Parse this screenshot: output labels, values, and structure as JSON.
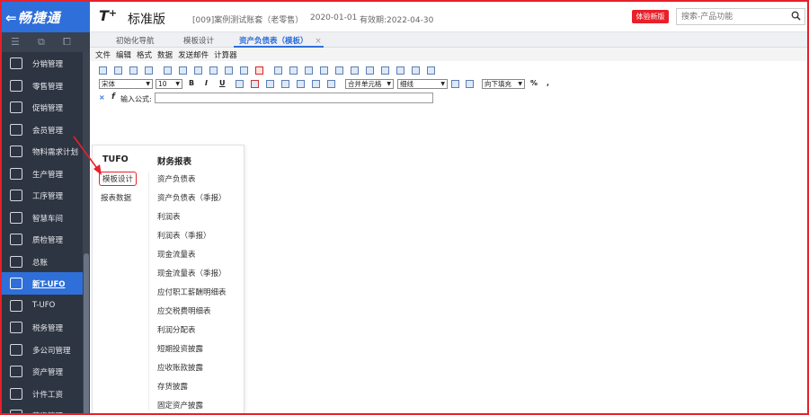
{
  "header": {
    "logo": "⇐畅捷通",
    "product": "T",
    "product_sup": "+",
    "edition": "标准版",
    "account": "[009]案例测试账套（老零售）",
    "date": "2020-01-01",
    "validity": "有效期:2022-04-30",
    "trial_button": "体验新版",
    "search_placeholder": "搜索-产品功能"
  },
  "sidebar": {
    "items": [
      {
        "label": "分销管理",
        "icon": "org-chart-icon"
      },
      {
        "label": "零售管理",
        "icon": "store-icon"
      },
      {
        "label": "促销管理",
        "icon": "megaphone-icon"
      },
      {
        "label": "会员管理",
        "icon": "member-card-icon"
      },
      {
        "label": "物料需求计划",
        "icon": "cube-icon"
      },
      {
        "label": "生产管理",
        "icon": "production-icon"
      },
      {
        "label": "工序管理",
        "icon": "process-icon"
      },
      {
        "label": "智慧车间",
        "icon": "workshop-icon"
      },
      {
        "label": "质检管理",
        "icon": "shield-check-icon"
      },
      {
        "label": "总账",
        "icon": "ledger-icon"
      },
      {
        "label": "新T-UFO",
        "icon": "ufo-icon"
      },
      {
        "label": "T-UFO",
        "icon": "table-icon"
      },
      {
        "label": "税务管理",
        "icon": "tax-icon"
      },
      {
        "label": "多公司管理",
        "icon": "company-icon"
      },
      {
        "label": "资产管理",
        "icon": "bank-icon"
      },
      {
        "label": "计件工资",
        "icon": "wage-icon"
      },
      {
        "label": "薪资管理",
        "icon": "salary-icon"
      }
    ],
    "active_index": 10
  },
  "tabs": [
    {
      "label": "初始化导航"
    },
    {
      "label": "模板设计"
    },
    {
      "label": "资产负债表（模板）",
      "close": "×"
    }
  ],
  "menubar": [
    "文件",
    "编辑",
    "格式",
    "数据",
    "发送邮件",
    "计算器"
  ],
  "format_bar": {
    "font": "宋体",
    "size": "10",
    "bold": "B",
    "italic": "I",
    "underline": "U",
    "merge": "合并单元格",
    "border": "细线",
    "fill": "向下填充",
    "percent": "%",
    "comma": ","
  },
  "formula_bar": {
    "cancel": "×",
    "fx": "f",
    "label": "输入公式:"
  },
  "popup": {
    "left_header": "TUFO",
    "right_header": "财务报表",
    "left_items": [
      "模板设计",
      "报表数据"
    ],
    "right_items": [
      "资产负债表",
      "资产负债表（季报）",
      "利润表",
      "利润表（季报）",
      "现金流量表",
      "现金流量表（季报）",
      "应付职工薪酬明细表",
      "应交税费明细表",
      "利润分配表",
      "短期投资披露",
      "应收账款披露",
      "存货披露",
      "固定资产披露"
    ]
  },
  "colors": {
    "brand_blue": "#2f6fd9",
    "sidebar_bg": "#2e3542",
    "highlight_red": "#e8202a"
  }
}
